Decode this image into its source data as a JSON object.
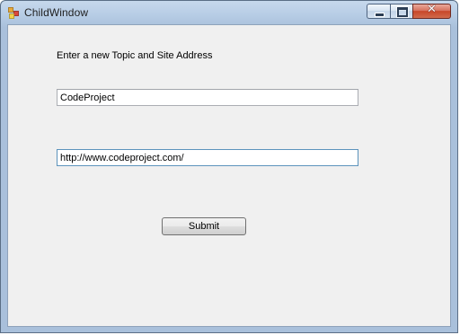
{
  "window": {
    "title": "ChildWindow",
    "icon": "winforms-app-icon",
    "caption_buttons": {
      "minimize_icon": "minimize-icon",
      "maximize_icon": "maximize-icon",
      "close_glyph": "✕"
    }
  },
  "form": {
    "instruction": "Enter a new Topic and Site Address",
    "topic_value": "CodeProject",
    "url_value": "http://www.codeproject.com/",
    "submit_label": "Submit"
  },
  "colors": {
    "titlebar": "#b9cee6",
    "client_bg": "#f0f0f0",
    "close_button": "#c84628",
    "focus_border": "#5c93bc"
  }
}
